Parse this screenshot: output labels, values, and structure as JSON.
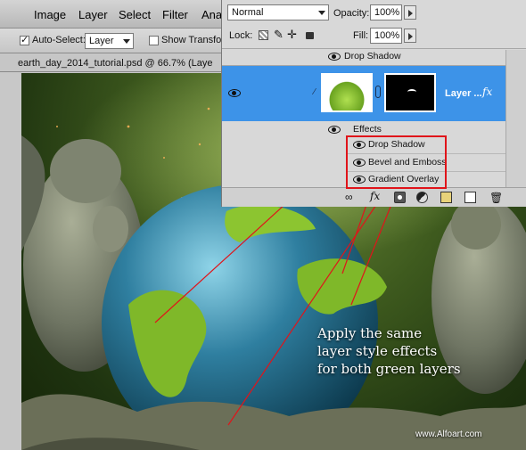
{
  "menu": {
    "items": [
      "Image",
      "Layer",
      "Select",
      "Filter",
      "Anal"
    ]
  },
  "options": {
    "auto_select_label": "Auto-Select:",
    "auto_select_checked": true,
    "auto_select_target": "Layer",
    "show_transform_label": "Show Transfor",
    "show_transform_checked": false
  },
  "document": {
    "tab_title": "earth_day_2014_tutorial.psd @ 66.7% (Laye"
  },
  "layers_panel": {
    "blend_mode": "Normal",
    "opacity_label": "Opacity:",
    "opacity_value": "100%",
    "lock_label": "Lock:",
    "fill_label": "Fill:",
    "fill_value": "100%",
    "prev_effect": "Drop Shadow",
    "layer_name": "Layer ...",
    "fx_badge": "fx",
    "effects_label": "Effects",
    "effects": [
      "Drop Shadow",
      "Bevel and Emboss",
      "Gradient Overlay"
    ]
  },
  "canvas": {
    "caption_lines": [
      "Apply the same",
      "layer style effects",
      "for both green layers"
    ],
    "watermark": "www.Alfoart.com"
  },
  "colors": {
    "selection_blue": "#3d93e8",
    "highlight_red": "#e0141a",
    "ocean": "#2f7fa0",
    "land_green": "#7fb829"
  }
}
